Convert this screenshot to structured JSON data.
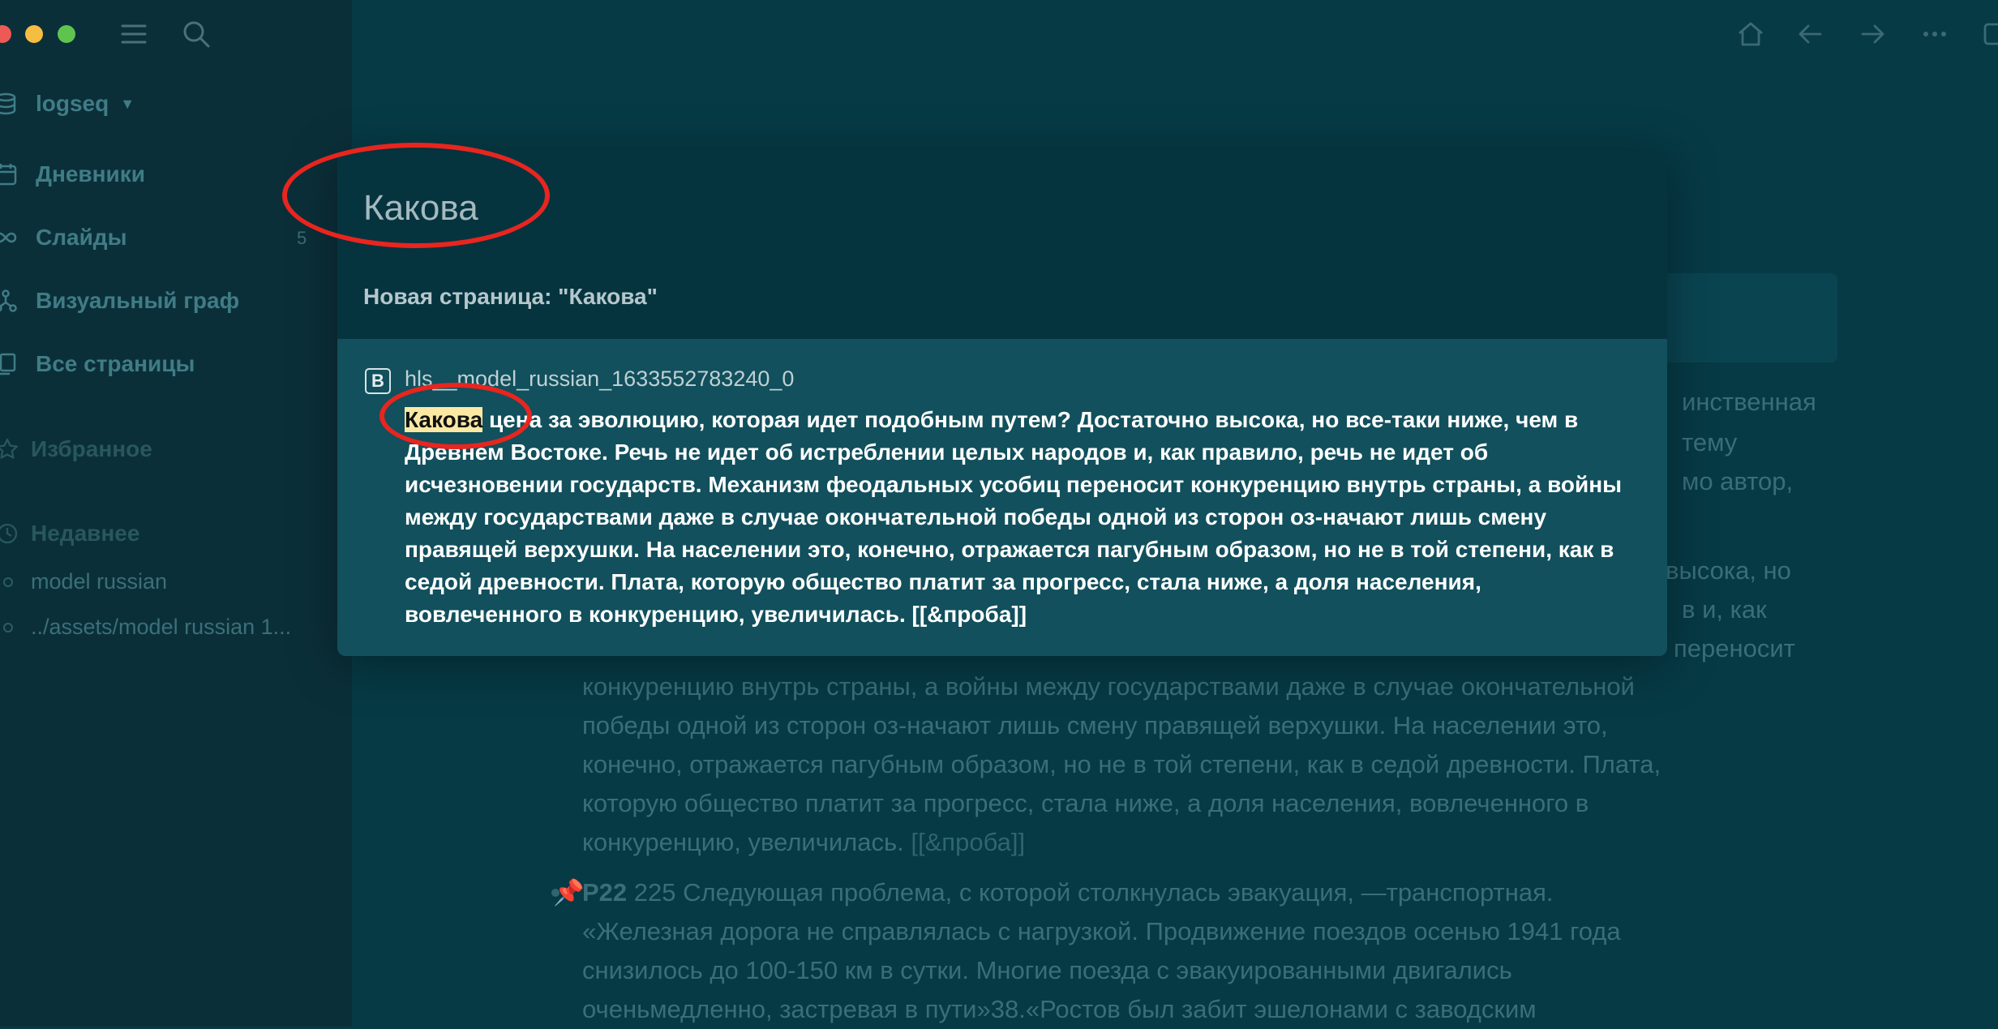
{
  "app": {
    "name": "logseq"
  },
  "sidebar": {
    "graph_name": "logseq",
    "nav": [
      {
        "label": "Дневники",
        "icon": "calendar-icon"
      },
      {
        "label": "Слайды",
        "icon": "infinity-icon",
        "count": "5"
      },
      {
        "label": "Визуальный граф",
        "icon": "graph-icon"
      },
      {
        "label": "Все страницы",
        "icon": "pages-icon"
      }
    ],
    "favorites_title": "Избранное",
    "recent_title": "Недавнее",
    "recent": [
      "model russian",
      "../assets/model russian 1..."
    ]
  },
  "search": {
    "query": "Какова",
    "new_page_label": "Новая страница:  \"Какова\"",
    "result": {
      "page": "hls__model_russian_1633552783240_0",
      "badge": "B",
      "highlight": "Какова",
      "text_rest": " цена за эволюцию, которая идет подобным путем? Достаточно высока, но все-таки ниже, чем в Древнем Востоке. Речь не идет об истреблении целых народов и, как правило, речь не идет об исчезновении государств. Механизм феодальных усобиц переносит конкуренцию внутрь страны, а войны между государствами даже в случае окончательной победы одной из сторон оз-начают лишь смену правящей верхушки. На населении это, конечно, отражается пагубным образом, но не в той степени, как в седой древности. Плата, которую общество платит за прогресс, стала ниже, а доля населения, вовлеченного в конкуренцию, увеличилась. [[&проба]]"
    }
  },
  "background": {
    "frag1": "инственная",
    "frag2": "тему",
    "frag3": "мо автор,",
    "frag4": "высока,  но",
    "frag5": "в и, как",
    "frag6": "переносит",
    "line1": "конкуренцию внутрь страны, а войны между государствами даже в случае окончательной",
    "line2": "победы одной из сторон оз-начают  лишь  смену  правящей  верхушки.  На  населении  это,",
    "line3": "конечно,  отражается  пагубным образом, но не в той степени, как в седой древности. Плата,",
    "line4": "которую общество платит за прогресс, стала ниже, а доля населения, вовлеченного в",
    "line5": "конкуренцию, увеличилась. ",
    "line5_link": "[[&проба]]",
    "block2_tag": "P22",
    "block2_line1": "  225  Следующая проблема,  с которой столкнулась  эвакуация, —транспортная.",
    "block2_line2": "«Железная дорога не  справлялась  с  нагрузкой.  Продвижение  поездов  осенью  1941  года",
    "block2_line3": "снизилось  до  100-150  км  в сутки. Многие поезда с эвакуированными двигались",
    "block2_line4": "оченьмедленно, застревая в пути»38.«Ростов  был  забит  эшелонами  с  заводским"
  },
  "colors": {
    "background": "#063a45",
    "sidebar": "#0b2f39",
    "modal_input_area": "#05343f",
    "result_bg": "#11505c",
    "highlight": "#fbe9a3",
    "annotation": "#e8251f"
  }
}
